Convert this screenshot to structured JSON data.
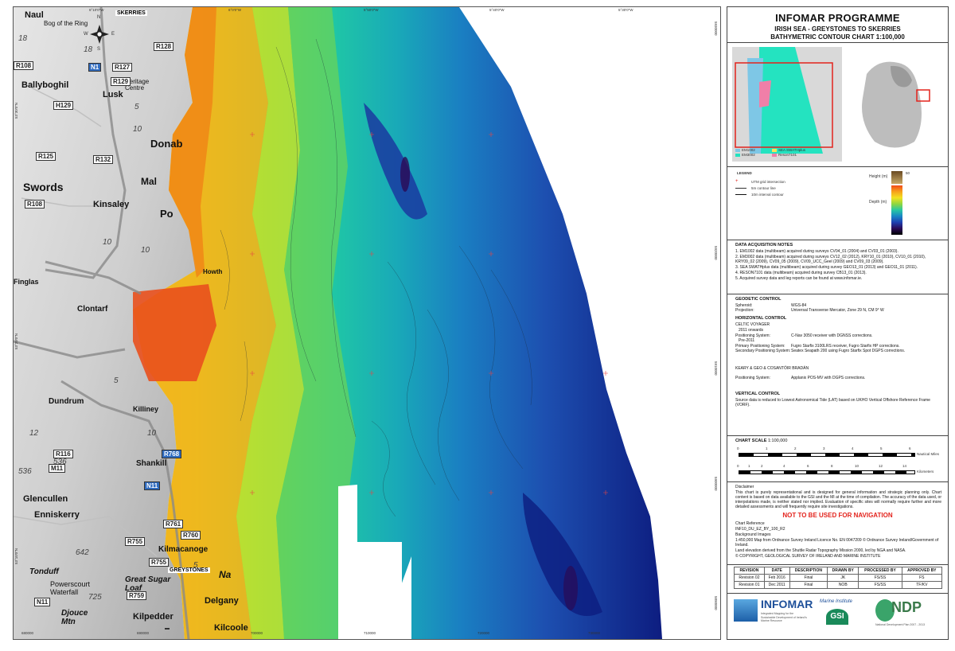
{
  "map": {
    "axis_top": [
      "6°10'0\"W",
      "6°0'0\"W",
      "5°50'0\"W",
      "5°40'0\"W",
      "5°30'0\"W"
    ],
    "axis_bottom": [
      "680000",
      "690000",
      "700000",
      "710000",
      "720000",
      "730000"
    ],
    "axis_left": [
      "53°30'0\"N",
      "53°20'0\"N",
      "53°10'0\"N"
    ],
    "axis_right": [
      "5930000",
      "5920000",
      "5910000",
      "5900000",
      "5890000"
    ],
    "places": [
      {
        "name": "Naul",
        "size": 11
      },
      {
        "name": "Bog of the Ring",
        "size": 9
      },
      {
        "name": "Ballyboghil",
        "size": 11
      },
      {
        "name": "Lusk",
        "size": 11
      },
      {
        "name": "Donab",
        "size": 13
      },
      {
        "name": "Swords",
        "size": 14
      },
      {
        "name": "Kinsaley",
        "size": 11
      },
      {
        "name": "Finglas",
        "size": 9
      },
      {
        "name": "Clontarf",
        "size": 10
      },
      {
        "name": "Howth",
        "size": 8
      },
      {
        "name": "Dundrum",
        "size": 10
      },
      {
        "name": "Killiney",
        "size": 9
      },
      {
        "name": "Shankill",
        "size": 10
      },
      {
        "name": "Glencullen",
        "size": 11
      },
      {
        "name": "Enniskerry",
        "size": 11
      },
      {
        "name": "Kilmacanoge",
        "size": 10
      },
      {
        "name": "Tonduff",
        "size": 10
      },
      {
        "name": "Powerscourt Waterfall",
        "size": 9
      },
      {
        "name": "Great Sugar Loaf",
        "size": 10
      },
      {
        "name": "Delgany",
        "size": 11
      },
      {
        "name": "Djouce Mtn",
        "size": 10
      },
      {
        "name": "Kilpedder",
        "size": 11
      },
      {
        "name": "Kilcoole",
        "size": 11
      },
      {
        "name": "Heritage Centre",
        "size": 8
      },
      {
        "name": "Mal",
        "size": 12
      },
      {
        "name": "Po",
        "size": 13
      },
      {
        "name": "Na",
        "size": 12
      }
    ],
    "towns": [
      "SKERRIES",
      "GREYSTONES"
    ],
    "roads": [
      "R128",
      "R127",
      "N1",
      "R108",
      "R129",
      "H129",
      "R125",
      "R132",
      "R108",
      "R116",
      "M11",
      "N11",
      "R768",
      "R761",
      "R760",
      "R755",
      "R755",
      "R759",
      "N11"
    ],
    "spot_heights": [
      "18",
      "18",
      "5",
      "10",
      "10",
      "10",
      "5",
      "10",
      "12",
      "536",
      "536",
      "642",
      "725",
      "5"
    ],
    "compass": {
      "n": "N",
      "e": "E",
      "s": "S",
      "w": "W"
    }
  },
  "panel": {
    "title": "INFOMAR PROGRAMME",
    "subtitle": "IRISH SEA - GREYSTONES TO SKERRIES",
    "chart": "BATHYMETRIC CONTOUR CHART 1:100,000",
    "locator_legend": [
      "EM1002",
      "SEA SWATHplus",
      "EM3002",
      "Reson7101"
    ],
    "legend": {
      "title": "LEGEND",
      "items": [
        "UTM grid intersection",
        "5m contour line",
        "10m interval contour"
      ],
      "height_label": "Height (m)",
      "depth_label": "Depth (m)",
      "height_top": "50"
    },
    "acquisition": {
      "title": "DATA ACQUISITION NOTES",
      "notes": [
        "1. EM1002 data (multibeam) acquired during surveys CV04_01 (2004) and CV03_01 (2003).",
        "2. EM3002 data (multibeam) acquired during surveys CV12_02 (2012), KRY10_01 (2010), CV10_01 (2010), KRY09_02 (2009), CV09_05 (2009), CV09_UCC_Geel (2009) and CV09_03 (2009).",
        "3. SEA SWATHplus data (multibeam) acquired during survey GEO13_01 (2013) and GEO11_01 (2011).",
        "4. RESON7101 data (multibeam) acquired during survey CB13_01 (2013).",
        "5. Acquired survey data and leg reports can be found at www.infomar.ie."
      ]
    },
    "geodetic": {
      "title": "GEODETIC CONTROL",
      "spheroid_k": "Spheroid:",
      "spheroid_v": "WGS-84",
      "projection_k": "Projection:",
      "projection_v": "Universal Transverse Mercator, Zone 29 N, CM 9° W",
      "horizontal_title": "HORIZONTAL CONTROL",
      "vessel": "CELTIC VOYAGER",
      "onwards": "2011 onwards",
      "pos_k": "Positioning System:",
      "pos_v": "C-Nav 3050 receiver with DGNSS corrections.",
      "pre": "Pre-2011",
      "prim_k": "Primary Positioning System:",
      "prim_v": "Fugro Starfix 3100LRS receiver, Fugro Starfix HP corrections.",
      "sec_k": "Secondary Positioning System:",
      "sec_v": "Seatex Seapath 200 using Fugro Starfix Spot DGPS corrections.",
      "vessel2": "KEARY & GEO & COSANTÓIR BRADÁN",
      "pos2_k": "Positioning System:",
      "pos2_v": "Applanix POS-MV with DGPS corrections.",
      "vertical_title": "VERTICAL CONTROL",
      "vertical_text": "Source data is reduced to Lowest Astronomical Tide (LAT) based on UKHO Vertical Offshore Reference Frame (VORF)."
    },
    "scale": {
      "title": "CHART SCALE",
      "value": "1:100,000",
      "nm_ticks": [
        "0",
        "1",
        "2",
        "3",
        "4",
        "5",
        "6"
      ],
      "nm_label": "Nautical Miles",
      "km_ticks": [
        "0",
        "1",
        "2",
        "4",
        "6",
        "8",
        "10",
        "12",
        "14"
      ],
      "km_label": "Kilometers"
    },
    "disclaimer": {
      "title": "Disclaimer",
      "text": "This chart is purely representational and is designed for general information and strategic planning only. Chart content is based on data available to the GSI and the MI at the time of compilation. The accuracy of the data used, or interpolations made, is neither stated nor implied. Evaluation of specific sites will normally require further and more detailed assessments and will frequently require site investigations.",
      "warning": "NOT TO BE USED FOR NAVIGATION",
      "ref_label": "Chart Reference",
      "ref_value": "INF10_DU_EZ_BY_100_R2",
      "bg_label": "Background Images",
      "bg_text": "1:450,000 Map from Ordnance Survey Ireland Licence No. EN 0047209 © Ordnance Survey Ireland/Government of Ireland.",
      "bg_text2": "Land elevation derived from the Shuttle Radar Topography Mission 2000, led by NGA and NASA.",
      "copyright": "© COPYRIGHT, GEOLOGICAL SURVEY OF IRELAND AND MARINE INSTITUTE"
    },
    "revisions": {
      "headers": [
        "REVISION",
        "DATE",
        "DESCRIPTION",
        "DRAWN BY",
        "PROCESSED BY",
        "APPROVED BY"
      ],
      "rows": [
        [
          "Revision 02",
          "Feb 2016",
          "Final",
          "JK",
          "FS/SS",
          "FS"
        ],
        [
          "Revision 01",
          "Dec 2011",
          "Final",
          "NOB",
          "FS/SS",
          "TF/KV"
        ]
      ]
    },
    "logos": {
      "infomar": "INFOMAR",
      "infomar_sub": "Integrated Mapping for the Sustainable Development of Ireland's Marine Resource",
      "marine": "Marine Institute",
      "gsi": "GSI",
      "ndp": "NDP",
      "ndp_sub": "National Development Plan 2007 - 2013"
    }
  },
  "colors": {
    "deep": "#0b1a7a",
    "mid": "#1fb6a0",
    "shallow": "#f2a11b",
    "very_shallow": "#e8401c",
    "land": "#d9d9d9",
    "warning": "#e3231c"
  }
}
